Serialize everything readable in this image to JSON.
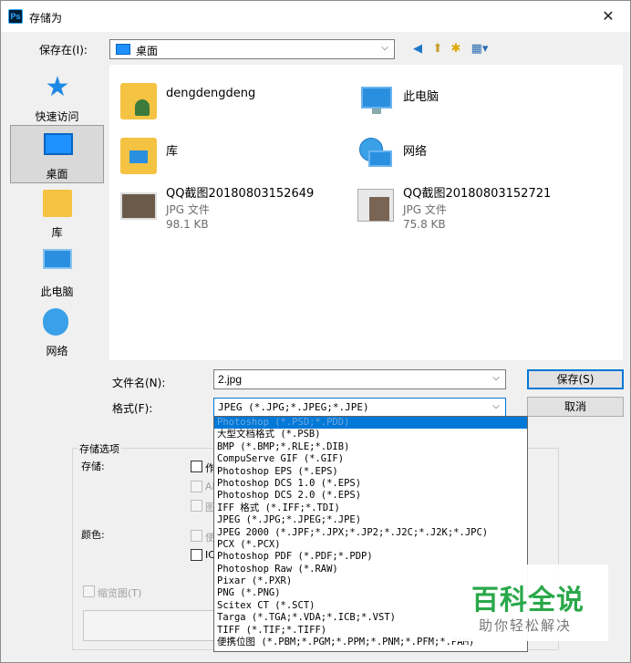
{
  "window": {
    "title": "存储为",
    "app_icon_text": "Ps",
    "close_glyph": "✕"
  },
  "save_in": {
    "label": "保存在(I):",
    "location": "桌面"
  },
  "places": [
    {
      "label": "快速访问",
      "icon": "star-icon"
    },
    {
      "label": "桌面",
      "icon": "desktop-icon",
      "selected": true
    },
    {
      "label": "库",
      "icon": "library-icon"
    },
    {
      "label": "此电脑",
      "icon": "computer-icon"
    },
    {
      "label": "网络",
      "icon": "network-icon"
    }
  ],
  "files": [
    {
      "name": "dengdengdeng",
      "icon": "user-folder-icon"
    },
    {
      "name": "此电脑",
      "icon": "computer-icon"
    },
    {
      "name": "库",
      "icon": "library-icon"
    },
    {
      "name": "网络",
      "icon": "network-icon"
    },
    {
      "name": "QQ截图20180803152649",
      "type": "JPG 文件",
      "size": "98.1 KB",
      "icon": "image-thumbnail"
    },
    {
      "name": "QQ截图20180803152721",
      "type": "JPG 文件",
      "size": "75.8 KB",
      "icon": "image-thumbnail"
    }
  ],
  "filename": {
    "label": "文件名(N):",
    "value": "2.jpg"
  },
  "format": {
    "label": "格式(F):",
    "value": "JPEG (*.JPG;*.JPEG;*.JPE)",
    "options": [
      "Photoshop (*.PSD;*.PDD)",
      "大型文档格式 (*.PSB)",
      "BMP (*.BMP;*.RLE;*.DIB)",
      "CompuServe GIF (*.GIF)",
      "Photoshop EPS (*.EPS)",
      "Photoshop DCS 1.0 (*.EPS)",
      "Photoshop DCS 2.0 (*.EPS)",
      "IFF 格式 (*.IFF;*.TDI)",
      "JPEG (*.JPG;*.JPEG;*.JPE)",
      "JPEG 2000 (*.JPF;*.JPX;*.JP2;*.J2C;*.J2K;*.JPC)",
      "PCX (*.PCX)",
      "Photoshop PDF (*.PDF;*.PDP)",
      "Photoshop Raw (*.RAW)",
      "Pixar (*.PXR)",
      "PNG (*.PNG)",
      "Scitex CT (*.SCT)",
      "Targa (*.TGA;*.VDA;*.ICB;*.VST)",
      "TIFF (*.TIF;*.TIFF)",
      "便携位图 (*.PBM;*.PGM;*.PPM;*.PNM;*.PFM;*.PAM)"
    ]
  },
  "buttons": {
    "save": "保存(S)",
    "cancel": "取消"
  },
  "save_options": {
    "group_title": "存储选项",
    "save_label": "存储:",
    "color_label": "颜色:",
    "partial_1": "作",
    "partial_2": "Al",
    "partial_3": "图",
    "partial_4": "使",
    "partial_5": "IC",
    "thumbnail": "缩览图(T)"
  },
  "watermark": {
    "title": "百科全说",
    "subtitle": "助你轻松解决"
  },
  "colors": {
    "accent": "#0078d7",
    "watermark_green": "#2aa84a"
  }
}
